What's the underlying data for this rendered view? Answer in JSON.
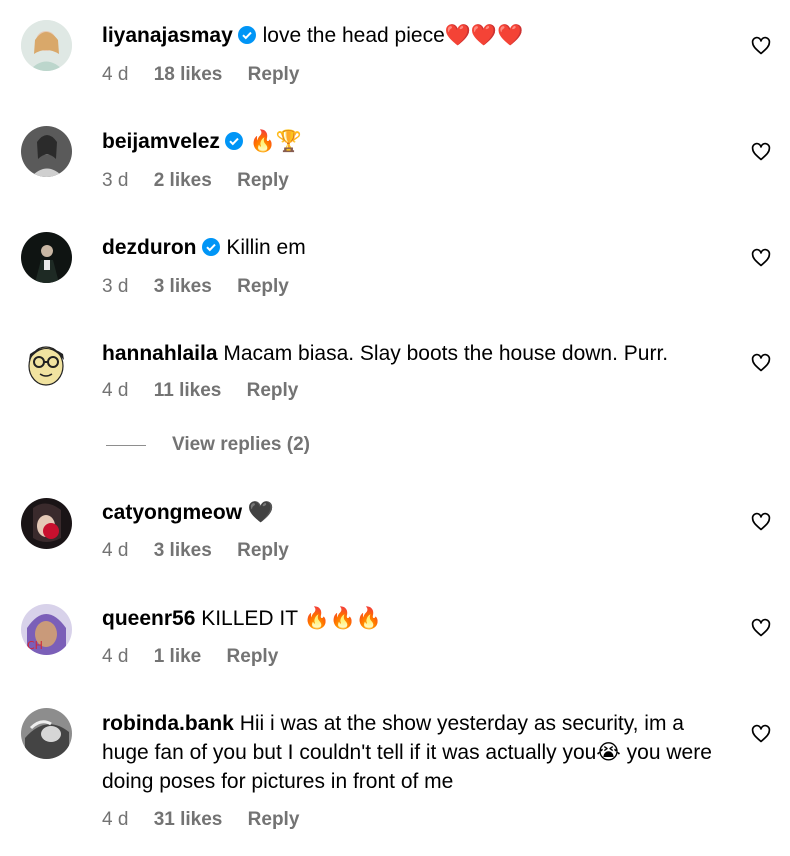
{
  "comments": [
    {
      "username": "liyanajasmay",
      "verified": true,
      "text": "love the head piece❤️❤️❤️",
      "age": "4 d",
      "likes": "18 likes",
      "reply": "Reply"
    },
    {
      "username": "beijamvelez",
      "verified": true,
      "text": "🔥🏆",
      "age": "3 d",
      "likes": "2 likes",
      "reply": "Reply"
    },
    {
      "username": "dezduron",
      "verified": true,
      "text": "Killin em",
      "age": "3 d",
      "likes": "3 likes",
      "reply": "Reply"
    },
    {
      "username": "hannahlaila",
      "verified": false,
      "text": "Macam biasa. Slay boots the house down. Purr.",
      "age": "4 d",
      "likes": "11 likes",
      "reply": "Reply",
      "view_replies": "View replies (2)"
    },
    {
      "username": "catyongmeow",
      "verified": false,
      "text": "🖤",
      "age": "4 d",
      "likes": "3 likes",
      "reply": "Reply"
    },
    {
      "username": "queenr56",
      "verified": false,
      "text": "KILLED IT 🔥🔥🔥",
      "age": "4 d",
      "likes": "1 like",
      "reply": "Reply"
    },
    {
      "username": "robinda.bank",
      "verified": false,
      "text": "Hii i was at the show yesterday as security, im a huge fan of you but I couldn't tell if it was actually you😭 you were doing poses for pictures in front of me",
      "age": "4 d",
      "likes": "31 likes",
      "reply": "Reply"
    }
  ],
  "icons": {
    "like": "heart-outline-icon",
    "verified": "verified-badge-icon"
  },
  "colors": {
    "meta_text": "#737373",
    "verified_blue": "#0095f6"
  }
}
